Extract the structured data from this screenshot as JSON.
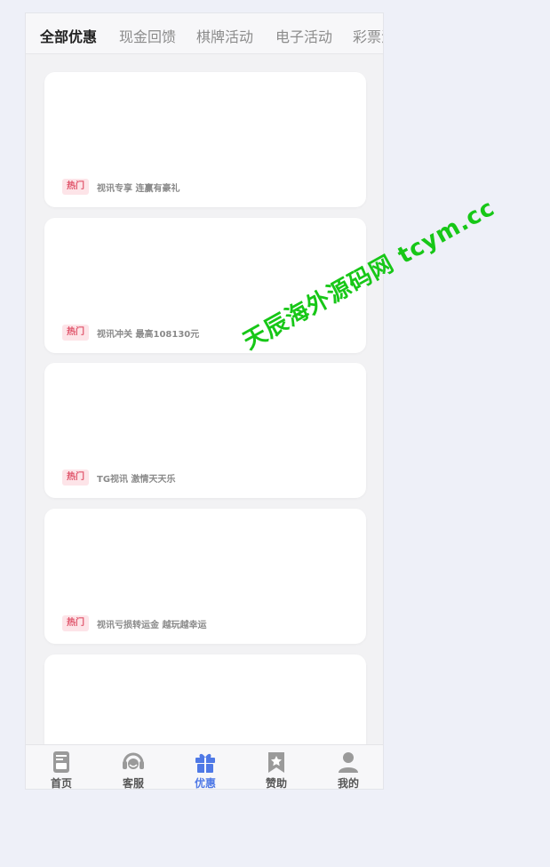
{
  "tabs": [
    {
      "label": "全部优惠",
      "active": true
    },
    {
      "label": "现金回馈",
      "active": false
    },
    {
      "label": "棋牌活动",
      "active": false
    },
    {
      "label": "电子活动",
      "active": false
    },
    {
      "label": "彩票活动",
      "active": false
    }
  ],
  "promotions": [
    {
      "badge": "热门",
      "title": "视讯专享 连赢有豪礼"
    },
    {
      "badge": "热门",
      "title": "视讯冲关 最高108130元"
    },
    {
      "badge": "热门",
      "title": "TG视讯 激情天天乐"
    },
    {
      "badge": "热门",
      "title": "视讯亏损转运金 越玩越幸运"
    }
  ],
  "tabbar": {
    "items": [
      {
        "label": "首页",
        "icon": "home-icon",
        "active": false
      },
      {
        "label": "客服",
        "icon": "headset-icon",
        "active": false
      },
      {
        "label": "优惠",
        "icon": "gift-icon",
        "active": true
      },
      {
        "label": "赞助",
        "icon": "bookmark-star-icon",
        "active": false
      },
      {
        "label": "我的",
        "icon": "user-icon",
        "active": false
      }
    ]
  },
  "watermark": "天辰海外源码网 tcym.cc",
  "colors": {
    "accent": "#4f79e6",
    "badge_text": "#e0556b",
    "badge_bg": "#fde4e8",
    "watermark": "#17c717"
  }
}
